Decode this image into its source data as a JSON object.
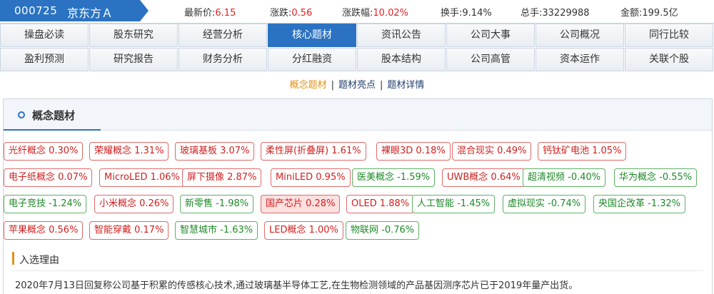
{
  "header": {
    "code": "000725",
    "name": "京东方Ａ",
    "stats": [
      {
        "label": "最新价:",
        "value": "6.15"
      },
      {
        "label": "涨跌:",
        "value": "0.56"
      },
      {
        "label": "涨跌幅:",
        "value": "10.02%"
      },
      {
        "label": "换手:",
        "value": "9.14%"
      },
      {
        "label": "总手:",
        "value": "33229988"
      },
      {
        "label": "金额:",
        "value": "199.5亿"
      }
    ]
  },
  "nav": {
    "row1": [
      "操盘必读",
      "股东研究",
      "经营分析",
      "核心题材",
      "资讯公告",
      "公司大事",
      "公司概况",
      "同行比较"
    ],
    "row2": [
      "盈利预测",
      "研究报告",
      "财务分析",
      "分红融资",
      "股本结构",
      "公司高管",
      "资本运作",
      "关联个股"
    ],
    "active": "核心题材"
  },
  "subnav": {
    "items": [
      "概念题材",
      "题材亮点",
      "题材详情"
    ],
    "separator": "|"
  },
  "section": {
    "title": "概念题材"
  },
  "tags": [
    {
      "label": "光纤概念 0.30%",
      "trend": "up"
    },
    {
      "label": "荣耀概念 1.31%",
      "trend": "up"
    },
    {
      "label": "玻璃基板 3.07%",
      "trend": "up"
    },
    {
      "label": "柔性屏(折叠屏) 1.61%",
      "trend": "up"
    },
    {
      "label": "裸眼3D 0.18%",
      "trend": "up"
    },
    {
      "label": "混合现实 0.49%",
      "trend": "up"
    },
    {
      "label": "钙钛矿电池 1.05%",
      "trend": "up"
    },
    {
      "label": "电子纸概念 0.07%",
      "trend": "up"
    },
    {
      "label": "MicroLED 1.06%",
      "trend": "up"
    },
    {
      "label": "屏下摄像 2.87%",
      "trend": "up"
    },
    {
      "label": "MiniLED 0.95%",
      "trend": "up"
    },
    {
      "label": "医美概念 -1.59%",
      "trend": "down"
    },
    {
      "label": "UWB概念 0.64%",
      "trend": "up"
    },
    {
      "label": "超清视频 -0.40%",
      "trend": "down"
    },
    {
      "label": "华为概念 -0.55%",
      "trend": "down"
    },
    {
      "label": "电子竞技 -1.24%",
      "trend": "down"
    },
    {
      "label": "小米概念 0.26%",
      "trend": "up"
    },
    {
      "label": "新零售 -1.98%",
      "trend": "down"
    },
    {
      "label": "国产芯片 0.28%",
      "trend": "up",
      "highlight": true
    },
    {
      "label": "OLED 1.88%",
      "trend": "up"
    },
    {
      "label": "人工智能 -1.45%",
      "trend": "down"
    },
    {
      "label": "虚拟现实 -0.74%",
      "trend": "down"
    },
    {
      "label": "央国企改革 -1.32%",
      "trend": "down"
    },
    {
      "label": "苹果概念 0.56%",
      "trend": "up"
    },
    {
      "label": "智能穿戴 0.17%",
      "trend": "up"
    },
    {
      "label": "智慧城市 -1.63%",
      "trend": "down"
    },
    {
      "label": "LED概念 1.00%",
      "trend": "up"
    },
    {
      "label": "物联网 -0.76%",
      "trend": "down"
    }
  ],
  "reason": {
    "title": "入选理由",
    "text": "2020年7月13日回复称公司基于积累的传感核心技术,通过玻璃基半导体工艺,在生物检测领域的产品基因测序芯片已于2019年量产出货。"
  },
  "colors": {
    "accent": "#2b73c2",
    "up": "#d21f1f",
    "down": "#1d8a27",
    "subnav_active": "#e09318"
  }
}
